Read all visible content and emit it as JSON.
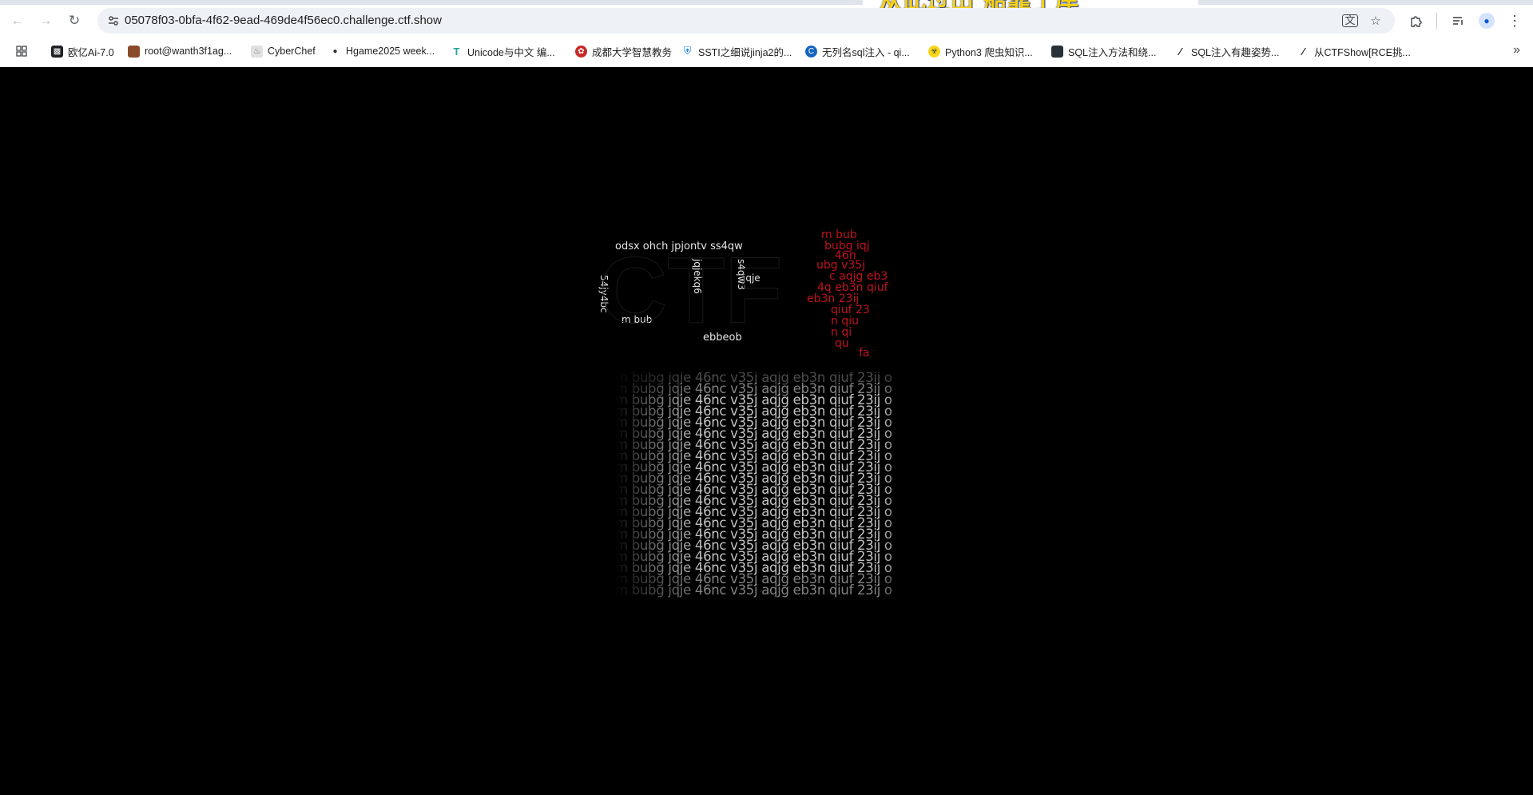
{
  "browser": {
    "tab_peek_text": "从此过山 船靠了岸",
    "url": "05078f03-0bfa-4f62-9ead-469de4f56ec0.challenge.ctf.show",
    "icons": {
      "back": "arrow-left-icon",
      "forward": "arrow-right-icon",
      "reload": "reload-icon",
      "site_info": "tune-icon",
      "translate": "translate-icon",
      "bookmark_star": "star-icon",
      "extensions": "puzzle-icon",
      "reading_list": "reading-list-icon",
      "profile": "profile-icon",
      "menu": "kebab-menu-icon"
    }
  },
  "bookmarks": [
    {
      "label": "欧亿Ai-7.0",
      "icon": "robot-icon",
      "color": "#202124"
    },
    {
      "label": "root@wanth3f1ag...",
      "icon": "avatar-icon",
      "color": "#8a4b2b"
    },
    {
      "label": "CyberChef",
      "icon": "chef-hat-icon",
      "color": "#bdbdbd"
    },
    {
      "label": "Hgame2025 week...",
      "icon": "user-icon",
      "color": "#333333"
    },
    {
      "label": "Unicode与中文 编...",
      "icon": "t-icon",
      "color": "#26a69a"
    },
    {
      "label": "成都大学智慧教务",
      "icon": "seal-icon",
      "color": "#c62828"
    },
    {
      "label": "SSTI之细说jinja2的...",
      "icon": "shield-icon",
      "color": "#1e88e5"
    },
    {
      "label": "无列名sql注入 - qi...",
      "icon": "circle-c-icon",
      "color": "#1565c0"
    },
    {
      "label": "Python3 爬虫知识...",
      "icon": "biohazard-icon",
      "color": "#f9a825"
    },
    {
      "label": "SQL注入方法和绕...",
      "icon": "tile-icon",
      "color": "#263238"
    },
    {
      "label": "SQL注入有趣姿势...",
      "icon": "slash-icon",
      "color": "#212121"
    },
    {
      "label": "从CTFShow[RCE挑...",
      "icon": "slash-icon",
      "color": "#212121"
    }
  ],
  "page": {
    "logo_text": "CTF",
    "logo_text_stream": "bubg jqje 46nc v35j aqjg eb3n qiuf 23ij odsx ohch jpjontv ss4qw",
    "reflection_line": "m bubg jqje 46nc v35j aqjg eb3n qiuf 23ij o",
    "reflection_line_count": 20,
    "accent_red": "#c1121f",
    "text_gray": "#d9d9d9"
  }
}
